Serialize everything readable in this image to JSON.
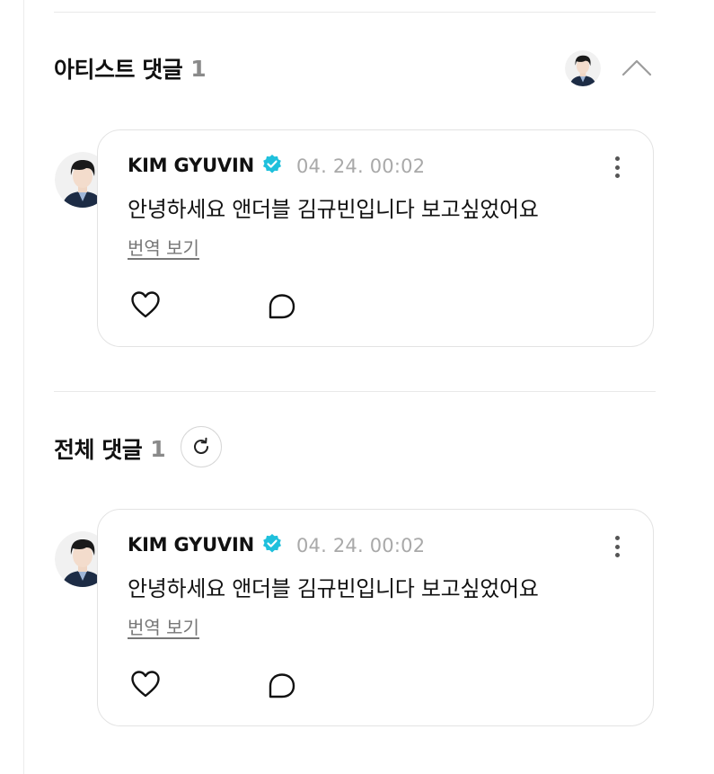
{
  "artist_section": {
    "title": "아티스트 댓글",
    "count": "1"
  },
  "all_section": {
    "title": "전체 댓글",
    "count": "1"
  },
  "comments": [
    {
      "author": "KIM GYUVIN",
      "date": "04. 24. 00:02",
      "text": "안녕하세요 앤더블 김규빈입니다 보고싶었어요",
      "translate_label": "번역 보기"
    },
    {
      "author": "KIM GYUVIN",
      "date": "04. 24. 00:02",
      "text": "안녕하세요 앤더블 김규빈입니다 보고싶었어요",
      "translate_label": "번역 보기"
    }
  ],
  "icons": {
    "verified": "verified-badge-icon",
    "more": "more-vertical-icon",
    "like": "heart-icon",
    "reply": "comment-bubble-icon",
    "refresh": "refresh-icon",
    "collapse": "chevron-up-icon"
  },
  "colors": {
    "verified": "#1fc0dc",
    "muted": "#8a8a8a"
  }
}
